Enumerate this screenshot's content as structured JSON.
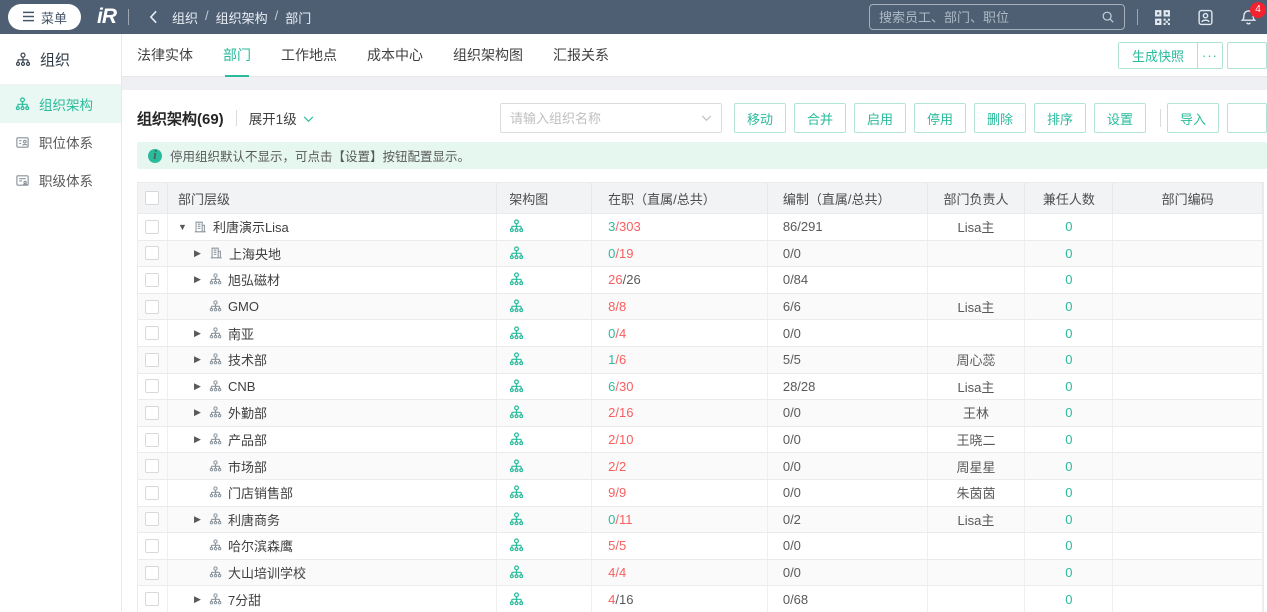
{
  "colors": {
    "accent_green": "#2abb9c",
    "alert_red": "#f75f5f",
    "topbar_bg": "#4e5f73",
    "notice_bg": "#e6f7f0",
    "badge_red": "#f5222d"
  },
  "topbar": {
    "menu_label": "菜单",
    "logo_text": "iR",
    "breadcrumb": [
      "组织",
      "组织架构",
      "部门"
    ],
    "breadcrumb_sep": "/",
    "search_placeholder": "搜索员工、部门、职位",
    "notification_count": "4"
  },
  "sidebar": {
    "section_label": "组织",
    "items": [
      {
        "label": "组织架构",
        "icon": "org-structure-icon",
        "active": true
      },
      {
        "label": "职位体系",
        "icon": "position-system-icon",
        "active": false
      },
      {
        "label": "职级体系",
        "icon": "grade-system-icon",
        "active": false
      }
    ]
  },
  "tabs": {
    "items": [
      "法律实体",
      "部门",
      "工作地点",
      "成本中心",
      "组织架构图",
      "汇报关系"
    ],
    "active_index": 1,
    "snapshot_label": "生成快照",
    "more_label": "···"
  },
  "toolbar": {
    "title": "组织架构(69)",
    "expand_label": "展开1级",
    "org_select_placeholder": "请输入组织名称",
    "buttons": [
      "移动",
      "合并",
      "启用",
      "停用",
      "删除",
      "排序",
      "设置"
    ],
    "import_label": "导入"
  },
  "notice": {
    "text": "停用组织默认不显示，可点击【设置】按钮配置显示。"
  },
  "table": {
    "headers": [
      "部门层级",
      "架构图",
      "在职（直属/总共）",
      "编制（直属/总共）",
      "部门负责人",
      "兼任人数",
      "部门编码"
    ],
    "rows": [
      {
        "name": "利唐演示Lisa",
        "level": 0,
        "arrow": "expanded",
        "icon": "building-icon",
        "active_direct": "3",
        "active_total": "303",
        "ad_color": "g",
        "at_color": "r",
        "headcount": "86/291",
        "manager": "Lisa主",
        "concurrent": "0",
        "code": ""
      },
      {
        "name": "上海央地",
        "level": 1,
        "arrow": "collapsed",
        "icon": "building-icon",
        "active_direct": "0",
        "active_total": "19",
        "ad_color": "g",
        "at_color": "r",
        "headcount": "0/0",
        "manager": "",
        "concurrent": "0",
        "code": ""
      },
      {
        "name": "旭弘磁材",
        "level": 1,
        "arrow": "collapsed",
        "icon": "org-icon",
        "active_direct": "26",
        "active_total": "26",
        "ad_color": "r",
        "at_color": "d",
        "headcount": "0/84",
        "manager": "",
        "concurrent": "0",
        "code": ""
      },
      {
        "name": "GMO",
        "level": 1,
        "arrow": "none",
        "icon": "org-icon",
        "active_direct": "8",
        "active_total": "8",
        "ad_color": "r",
        "at_color": "r",
        "headcount": "6/6",
        "manager": "Lisa主",
        "concurrent": "0",
        "code": ""
      },
      {
        "name": "南亚",
        "level": 1,
        "arrow": "collapsed",
        "icon": "org-icon",
        "active_direct": "0",
        "active_total": "4",
        "ad_color": "g",
        "at_color": "r",
        "headcount": "0/0",
        "manager": "",
        "concurrent": "0",
        "code": ""
      },
      {
        "name": "技术部",
        "level": 1,
        "arrow": "collapsed",
        "icon": "org-icon",
        "active_direct": "1",
        "active_total": "6",
        "ad_color": "g",
        "at_color": "r",
        "headcount": "5/5",
        "manager": "周心蕊",
        "concurrent": "0",
        "code": ""
      },
      {
        "name": "CNB",
        "level": 1,
        "arrow": "collapsed",
        "icon": "org-icon",
        "active_direct": "6",
        "active_total": "30",
        "ad_color": "g",
        "at_color": "r",
        "headcount": "28/28",
        "manager": "Lisa主",
        "concurrent": "0",
        "code": ""
      },
      {
        "name": "外勤部",
        "level": 1,
        "arrow": "collapsed",
        "icon": "org-icon",
        "active_direct": "2",
        "active_total": "16",
        "ad_color": "r",
        "at_color": "r",
        "headcount": "0/0",
        "manager": "王林",
        "concurrent": "0",
        "code": ""
      },
      {
        "name": "产品部",
        "level": 1,
        "arrow": "collapsed",
        "icon": "org-icon",
        "active_direct": "2",
        "active_total": "10",
        "ad_color": "r",
        "at_color": "r",
        "headcount": "0/0",
        "manager": "王晓二",
        "concurrent": "0",
        "code": ""
      },
      {
        "name": "市场部",
        "level": 1,
        "arrow": "none",
        "icon": "org-icon",
        "active_direct": "2",
        "active_total": "2",
        "ad_color": "r",
        "at_color": "r",
        "headcount": "0/0",
        "manager": "周星星",
        "concurrent": "0",
        "code": ""
      },
      {
        "name": "门店销售部",
        "level": 1,
        "arrow": "none",
        "icon": "org-icon",
        "active_direct": "9",
        "active_total": "9",
        "ad_color": "r",
        "at_color": "r",
        "headcount": "0/0",
        "manager": "朱茵茵",
        "concurrent": "0",
        "code": ""
      },
      {
        "name": "利唐商务",
        "level": 1,
        "arrow": "collapsed",
        "icon": "org-icon",
        "active_direct": "0",
        "active_total": "11",
        "ad_color": "g",
        "at_color": "r",
        "headcount": "0/2",
        "manager": "Lisa主",
        "concurrent": "0",
        "code": ""
      },
      {
        "name": "哈尔滨森鹰",
        "level": 1,
        "arrow": "none",
        "icon": "org-icon",
        "active_direct": "5",
        "active_total": "5",
        "ad_color": "r",
        "at_color": "r",
        "headcount": "0/0",
        "manager": "",
        "concurrent": "0",
        "code": ""
      },
      {
        "name": "大山培训学校",
        "level": 1,
        "arrow": "none",
        "icon": "org-icon",
        "active_direct": "4",
        "active_total": "4",
        "ad_color": "r",
        "at_color": "r",
        "headcount": "0/0",
        "manager": "",
        "concurrent": "0",
        "code": ""
      },
      {
        "name": "7分甜",
        "level": 1,
        "arrow": "collapsed",
        "icon": "org-icon",
        "active_direct": "4",
        "active_total": "16",
        "ad_color": "r",
        "at_color": "d",
        "headcount": "0/68",
        "manager": "",
        "concurrent": "0",
        "code": ""
      }
    ]
  }
}
